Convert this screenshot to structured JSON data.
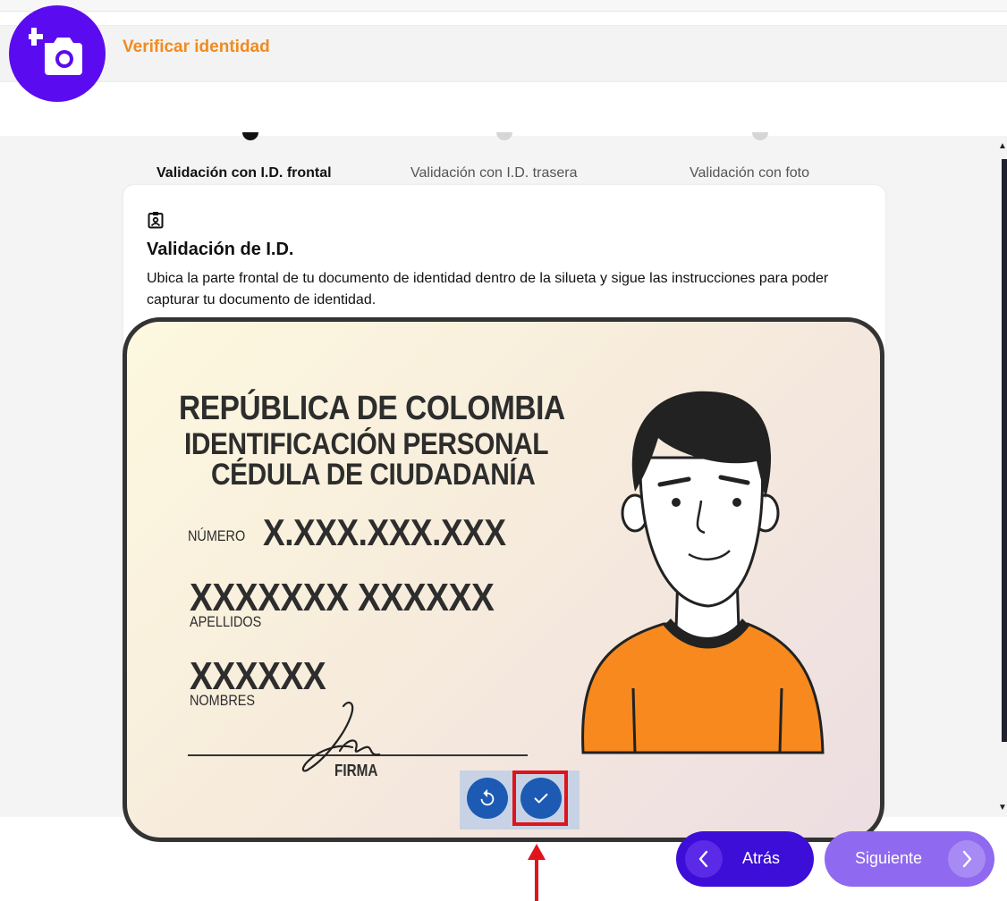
{
  "header": {
    "title": "Verificar identidad",
    "logo_icon": "add-photo-camera-icon"
  },
  "steps": [
    {
      "label": "Validación con I.D. frontal",
      "active": true
    },
    {
      "label": "Validación con I.D. trasera",
      "active": false
    },
    {
      "label": "Validación con foto",
      "active": false
    }
  ],
  "card": {
    "icon": "id-badge-icon",
    "title": "Validación de I.D.",
    "description": "Ubica la parte frontal de tu documento de identidad dentro de la silueta y sigue las instrucciones para poder capturar tu documento de identidad."
  },
  "id_card": {
    "line1": "REPÚBLICA DE COLOMBIA",
    "line2": "IDENTIFICACIÓN PERSONAL",
    "line3": "CÉDULA DE CIUDADANÍA",
    "numero_label": "NÚMERO",
    "numero_value": "X.XXX.XXX.XXX",
    "apellidos_value": "XXXXXXX XXXXXX",
    "apellidos_label": "APELLIDOS",
    "nombres_value": "XXXXXX",
    "nombres_label": "NOMBRES",
    "firma_label": "FIRMA"
  },
  "capture_actions": {
    "retake_icon": "retake-rotate-icon",
    "confirm_icon": "confirm-check-icon"
  },
  "navigation": {
    "back_label": "Atrás",
    "next_label": "Siguiente"
  },
  "colors": {
    "brand_purple": "#5b0bf0",
    "title_orange": "#f28a1e",
    "action_blue": "#1c5ab3",
    "highlight_red": "#e0141d",
    "back_button": "#3d0ed8",
    "next_button": "#8f6af0"
  }
}
